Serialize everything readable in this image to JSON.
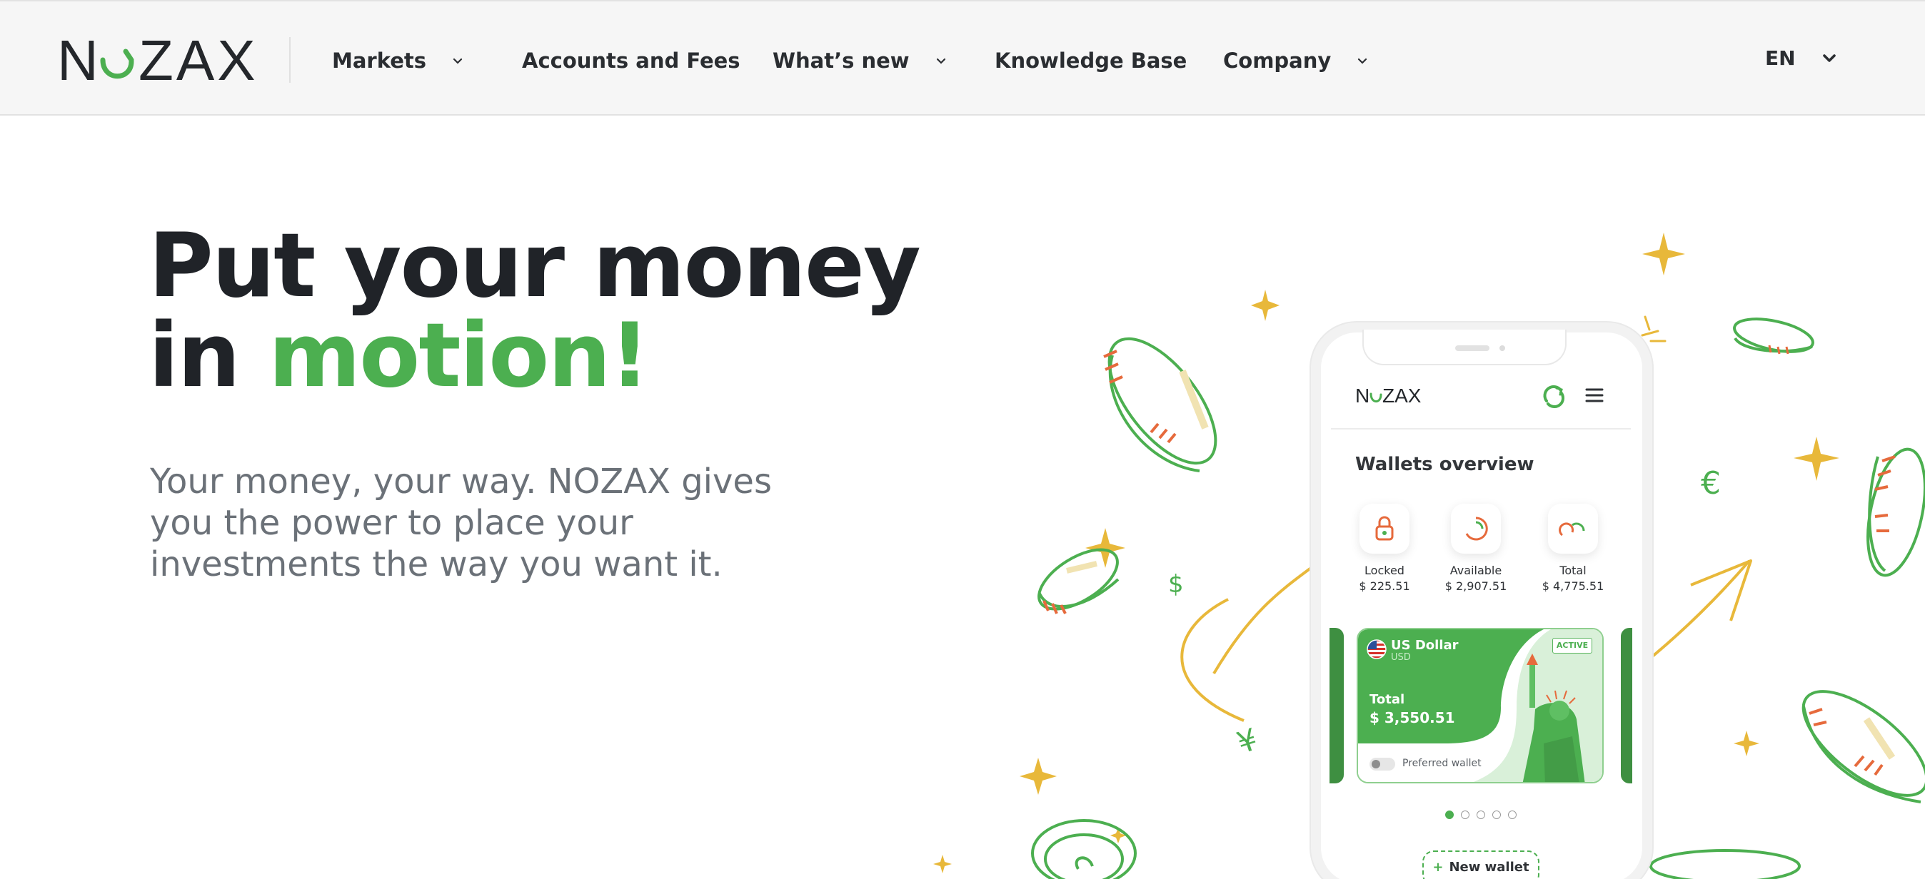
{
  "brand": {
    "name": "NOZAX",
    "accent": "#4caf50",
    "gold": "#e8b83a",
    "coin_red": "#e66a3c"
  },
  "nav": {
    "items": [
      {
        "label": "Markets",
        "has_dropdown": true
      },
      {
        "label": "Accounts and Fees",
        "has_dropdown": false
      },
      {
        "label": "What’s new",
        "has_dropdown": true
      },
      {
        "label": "Knowledge Base",
        "has_dropdown": false
      },
      {
        "label": "Company",
        "has_dropdown": true
      }
    ],
    "language": "EN"
  },
  "hero": {
    "title_line1": "Put your money",
    "title_line2_prefix": "in ",
    "title_line2_accent": "motion!",
    "subtitle": "Your money, your way. NOZAX gives you the power to place your investments the way you want it."
  },
  "phone": {
    "app_logo": "NOZAX",
    "section_title": "Wallets overview",
    "wallet_stats": [
      {
        "label": "Locked",
        "value": "$ 225.51",
        "icon": "lock-icon"
      },
      {
        "label": "Available",
        "value": "$ 2,907.51",
        "icon": "available-icon"
      },
      {
        "label": "Total",
        "value": "$ 4,775.51",
        "icon": "total-icon"
      }
    ],
    "card": {
      "currency": "US Dollar",
      "code": "USD",
      "status": "ACTIVE",
      "total_label": "Total",
      "total_value": "$ 3,550.51",
      "preferred_label": "Preferred wallet"
    },
    "pagination": {
      "count": 5,
      "active": 1
    },
    "new_wallet": "New wallet"
  },
  "decor": {
    "currency_symbols": [
      "$",
      "€",
      "¥"
    ]
  }
}
